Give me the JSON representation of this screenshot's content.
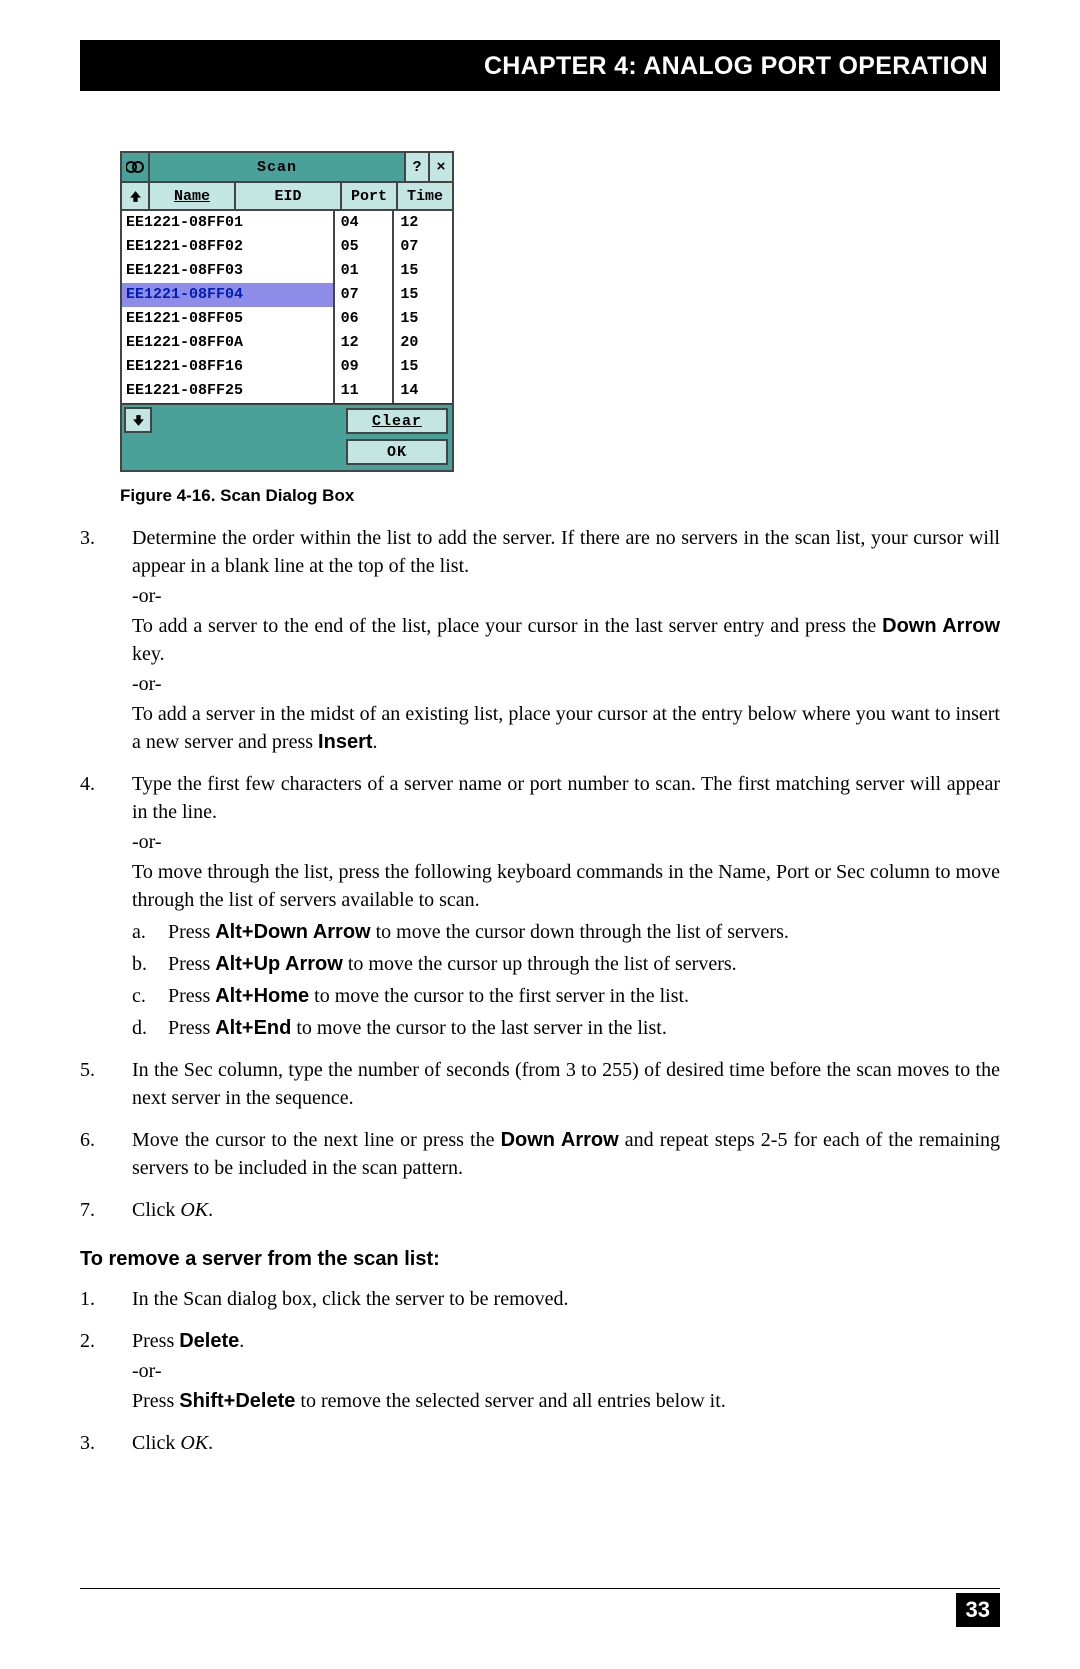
{
  "chapter_title": "CHAPTER 4: ANALOG PORT OPERATION",
  "dialog": {
    "title": "Scan",
    "help_symbol": "?",
    "close_symbol": "×",
    "headers": {
      "name": "Name",
      "eid": "EID",
      "port": "Port",
      "time": "Time"
    },
    "rows": [
      {
        "name": "EE1221-08FF01",
        "port": "04",
        "time": "12",
        "selected": false
      },
      {
        "name": "EE1221-08FF02",
        "port": "05",
        "time": "07",
        "selected": false
      },
      {
        "name": "EE1221-08FF03",
        "port": "01",
        "time": "15",
        "selected": false
      },
      {
        "name": "EE1221-08FF04",
        "port": "07",
        "time": "15",
        "selected": true
      },
      {
        "name": "EE1221-08FF05",
        "port": "06",
        "time": "15",
        "selected": false
      },
      {
        "name": "EE1221-08FF0A",
        "port": "12",
        "time": "20",
        "selected": false
      },
      {
        "name": "EE1221-08FF16",
        "port": "09",
        "time": "15",
        "selected": false
      },
      {
        "name": "EE1221-08FF25",
        "port": "11",
        "time": "14",
        "selected": false
      }
    ],
    "clear_label": "Clear",
    "ok_label": "OK"
  },
  "figure_caption": "Figure 4-16. Scan Dialog Box",
  "steps": {
    "s3": {
      "num": "3.",
      "p1": "Determine the order within the list to add the server. If there are no servers in the scan list, your cursor will appear in a blank line at the top of the list.",
      "or": "-or-",
      "p2a": "To add a server to the end of the list, place your cursor in the last server entry and press the ",
      "p2b": "Down Arrow",
      "p2c": " key.",
      "p3a": "To add a server in the midst of an existing list, place your cursor at the entry below where you want to insert a new server and press ",
      "p3b": "Insert",
      "p3c": "."
    },
    "s4": {
      "num": "4.",
      "p1": "Type the first few characters of a server name or port number to scan. The first matching server will appear in the line.",
      "or": "-or-",
      "p2": "To move through the list, press the following keyboard commands in the Name, Port or Sec column to move through the list of servers available to scan.",
      "a": {
        "num": "a.",
        "t1": "Press ",
        "b": "Alt+Down Arrow",
        "t2": " to move the cursor down through the list of servers."
      },
      "b": {
        "num": "b.",
        "t1": "Press ",
        "b": "Alt+Up Arrow",
        "t2": " to move the cursor up through the list of servers."
      },
      "c": {
        "num": "c.",
        "t1": "Press ",
        "b": "Alt+Home",
        "t2": " to move the cursor to the first server in the list."
      },
      "d": {
        "num": "d.",
        "t1": "Press ",
        "b": "Alt+End",
        "t2": " to move the cursor to the last server in the list."
      }
    },
    "s5": {
      "num": "5.",
      "p": "In the Sec column, type the number of seconds (from 3 to 255) of desired time before the scan moves to the next server in the sequence."
    },
    "s6": {
      "num": "6.",
      "t1": "Move the cursor to the next line or press the ",
      "b": "Down Arrow",
      "t2": " and repeat steps 2-5 for each of the remaining servers to be included in the scan pattern."
    },
    "s7": {
      "num": "7.",
      "t1": "Click ",
      "i": "OK",
      "t2": "."
    }
  },
  "section_heading": "To remove a server from the scan list:",
  "remove": {
    "r1": {
      "num": "1.",
      "p": "In the Scan dialog box, click the server to be removed."
    },
    "r2": {
      "num": "2.",
      "t1": "Press ",
      "b1": "Delete",
      "t2": ".",
      "or": "-or-",
      "t3": "Press ",
      "b2": "Shift+Delete",
      "t4": " to remove the selected server and all entries below it."
    },
    "r3": {
      "num": "3.",
      "t1": "Click ",
      "i": "OK",
      "t2": "."
    }
  },
  "page_number": "33"
}
